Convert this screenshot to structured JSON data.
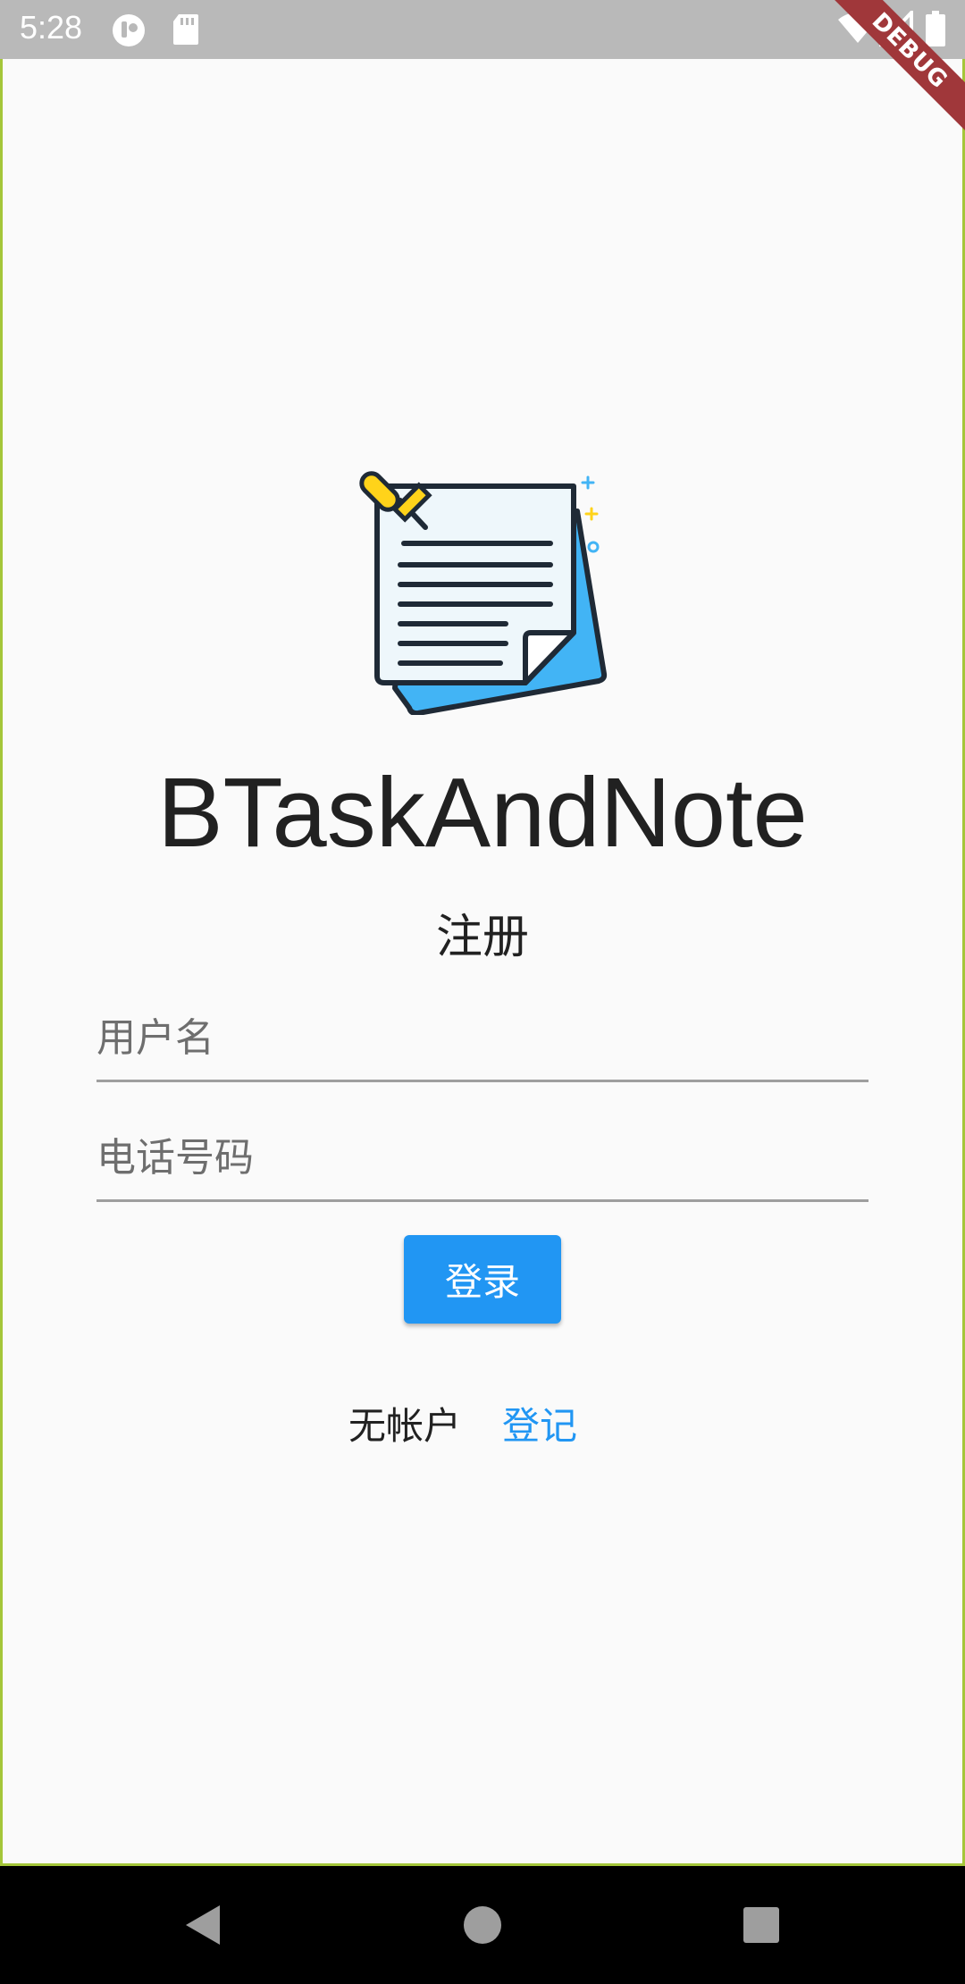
{
  "status_bar": {
    "time": "5:28",
    "left_icons": [
      "app-notification-icon",
      "sd-card-icon"
    ],
    "right_icons": [
      "wifi-icon",
      "cell-signal-icon",
      "battery-icon"
    ],
    "background": "#b9b9b9"
  },
  "debug_banner": {
    "label": "DEBUG",
    "color": "#a0373a"
  },
  "app": {
    "logo_icon": "note-with-pin-icon",
    "title": "BTaskAndNote",
    "subtitle": "注册"
  },
  "form": {
    "username": {
      "placeholder": "用户名",
      "value": ""
    },
    "phone": {
      "placeholder": "电话号码",
      "value": ""
    },
    "login_button": "登录"
  },
  "footer": {
    "no_account_text": "无帐户",
    "register_link": "登记"
  },
  "nav_bar": {
    "buttons": [
      "back-icon",
      "home-icon",
      "recents-icon"
    ]
  },
  "colors": {
    "accent": "#2196f3",
    "text": "#212121",
    "frame": "#a4c639"
  }
}
